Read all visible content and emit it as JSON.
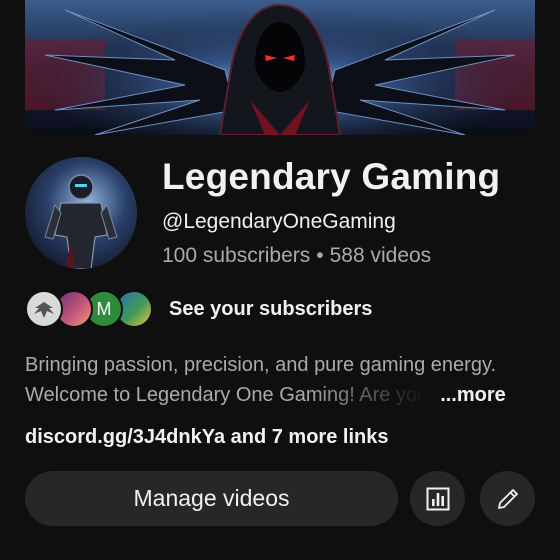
{
  "channel": {
    "name": "Legendary Gaming",
    "handle": "@LegendaryOneGaming",
    "subscribers": "100 subscribers",
    "separator": "•",
    "videos": "588 videos"
  },
  "subscribers_row": {
    "label": "See your subscribers",
    "avatars": [
      {
        "name": "subscriber-avatar-1",
        "letter": ""
      },
      {
        "name": "subscriber-avatar-2",
        "letter": ""
      },
      {
        "name": "subscriber-avatar-3",
        "letter": "M"
      },
      {
        "name": "subscriber-avatar-4",
        "letter": ""
      }
    ]
  },
  "description": {
    "line1": "Bringing passion, precision, and pure gaming energy.",
    "line2": "Welcome to Legendary One Gaming! Are you",
    "more_label": "...more"
  },
  "links": {
    "primary": "discord.gg/3J4dnkYa",
    "more": "and 7 more links"
  },
  "actions": {
    "manage_label": "Manage videos",
    "analytics_icon": "analytics-icon",
    "edit_icon": "pencil-icon"
  },
  "colors": {
    "background": "#0f0f0f",
    "button_bg": "#272727",
    "secondary_text": "#aaaaaa",
    "accent_eyes": "#ff2a2a"
  }
}
